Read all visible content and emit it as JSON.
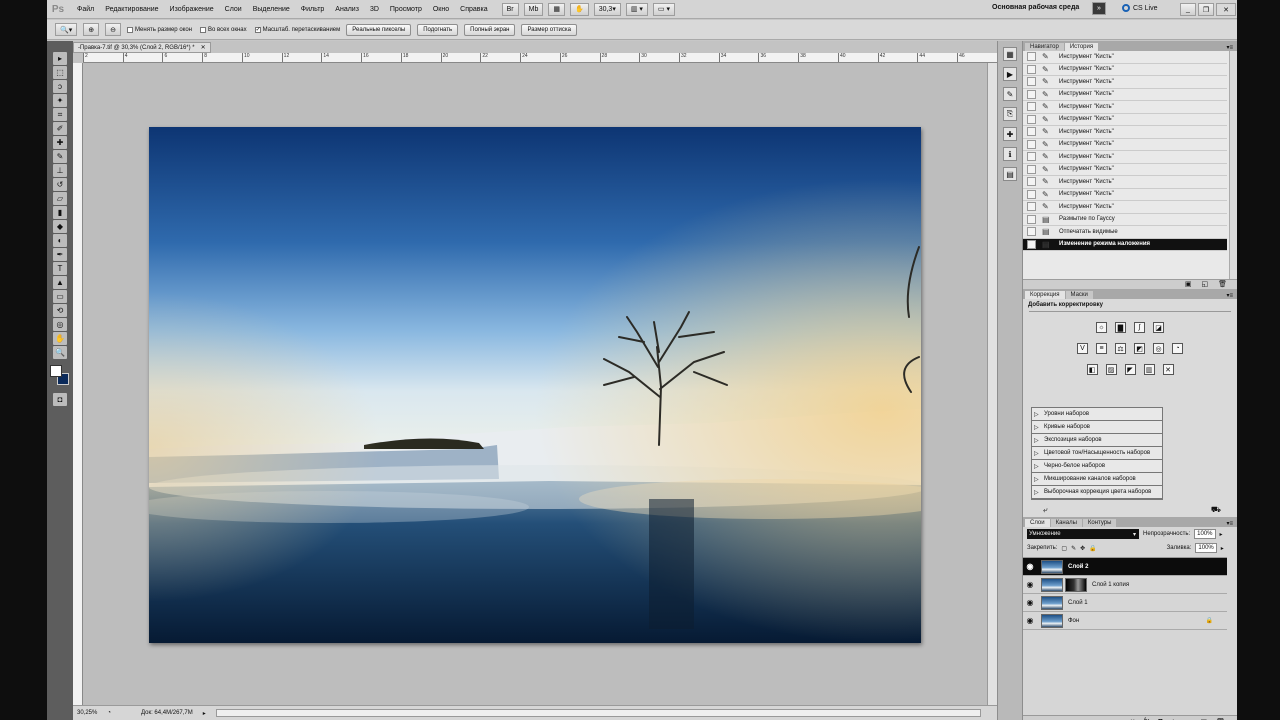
{
  "app": {
    "logo": "Ps"
  },
  "menu": [
    "Файл",
    "Редактирование",
    "Изображение",
    "Слои",
    "Выделение",
    "Фильтр",
    "Анализ",
    "3D",
    "Просмотр",
    "Окно",
    "Справка"
  ],
  "menu_right": {
    "zoom_value": "30,3",
    "workspace": "Основная рабочая среда",
    "cslive": "CS Live"
  },
  "options": {
    "checks": [
      {
        "label": "Менять размер окон",
        "checked": false
      },
      {
        "label": "Во всех окнах",
        "checked": false
      },
      {
        "label": "Масштаб. перетаскиванием",
        "checked": true
      }
    ],
    "buttons": [
      "Реальные пикселы",
      "Подогнать",
      "Полный экран",
      "Размер оттиска"
    ]
  },
  "document": {
    "tab_title": "-Правка-7.tif @ 30,3% (Слой 2, RGB/16*) *",
    "ruler_marks": [
      "2",
      "4",
      "6",
      "8",
      "10",
      "12",
      "14",
      "16",
      "18",
      "20",
      "22",
      "24",
      "26",
      "28",
      "30",
      "32",
      "34",
      "36",
      "38",
      "40",
      "42",
      "44",
      "46"
    ],
    "status_zoom": "30,25%",
    "status_doc": "Док: 64,4M/267,7M"
  },
  "history": {
    "tabs": [
      "Навигатор",
      "История"
    ],
    "items": [
      "Инструмент \"Кисть\"",
      "Инструмент \"Кисть\"",
      "Инструмент \"Кисть\"",
      "Инструмент \"Кисть\"",
      "Инструмент \"Кисть\"",
      "Инструмент \"Кисть\"",
      "Инструмент \"Кисть\"",
      "Инструмент \"Кисть\"",
      "Инструмент \"Кисть\"",
      "Инструмент \"Кисть\"",
      "Инструмент \"Кисть\"",
      "Инструмент \"Кисть\"",
      "Инструмент \"Кисть\"",
      "Размытие по Гауссу",
      "Отпечатать видимые",
      "Изменение режима наложения"
    ],
    "selected_index": 15
  },
  "corrections": {
    "tabs": [
      "Коррекция",
      "Маски"
    ],
    "title": "Добавить корректировку",
    "presets": [
      "Уровни наборов",
      "Кривые наборов",
      "Экспозиция наборов",
      "Цветовой тон/Насыщенность наборов",
      "Черно-белое наборов",
      "Микширование каналов наборов",
      "Выборочная коррекция цвета наборов"
    ]
  },
  "layers": {
    "tabs": [
      "Слои",
      "Каналы",
      "Контуры"
    ],
    "blend_mode": "Умножение",
    "opacity_label": "Непрозрачность:",
    "opacity": "100%",
    "lock_label": "Закрепить:",
    "fill_label": "Заливка:",
    "fill": "100%",
    "items": [
      {
        "name": "Слой 2",
        "selected": true,
        "mask": false
      },
      {
        "name": "Слой 1 копия",
        "selected": false,
        "mask": true
      },
      {
        "name": "Слой 1",
        "selected": false,
        "mask": false
      },
      {
        "name": "Фон",
        "selected": false,
        "mask": false
      }
    ]
  }
}
